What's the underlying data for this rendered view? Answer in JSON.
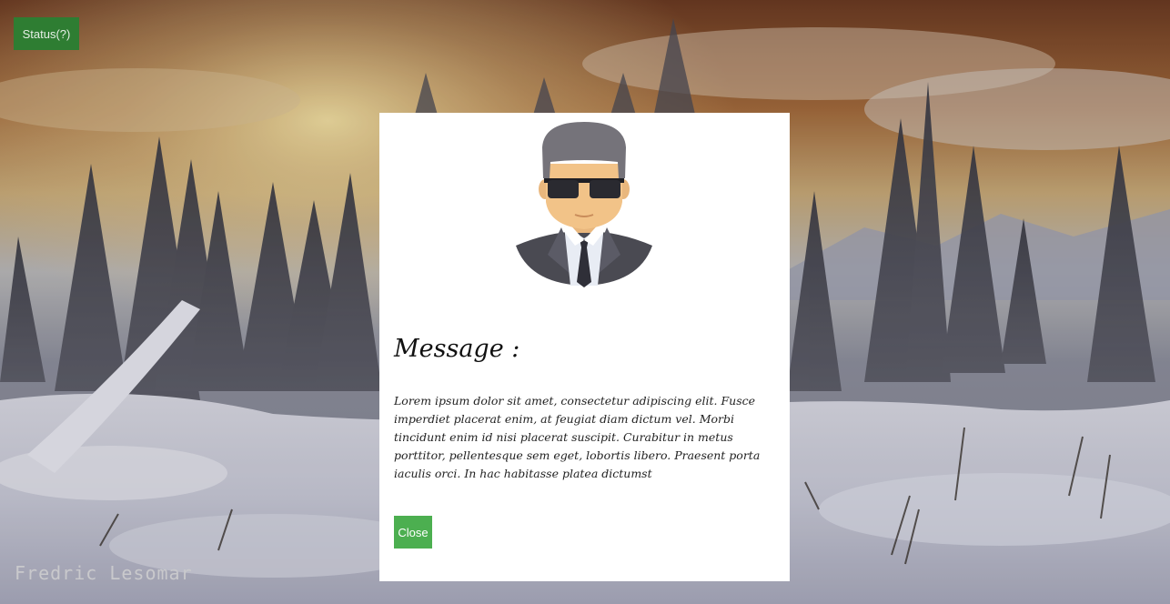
{
  "status_button": {
    "label": "Status(?)"
  },
  "signature": {
    "text": "Fredric Lesomar"
  },
  "modal": {
    "avatar_icon": "man-with-sunglasses-avatar-icon",
    "title": "Message :",
    "body": "Lorem ipsum dolor sit amet, consectetur adipiscing elit. Fusce imperdiet placerat enim, at feugiat diam dictum vel. Morbi tincidunt enim id nisi placerat suscipit. Curabitur in metus porttitor, pellentesque sem eget, lobortis libero. Praesent porta iaculis orci. In hac habitasse platea dictumst",
    "close_label": "Close"
  },
  "colors": {
    "status_button": "#2e7d32",
    "close_button": "#4caf50",
    "modal_background": "#ffffff"
  }
}
